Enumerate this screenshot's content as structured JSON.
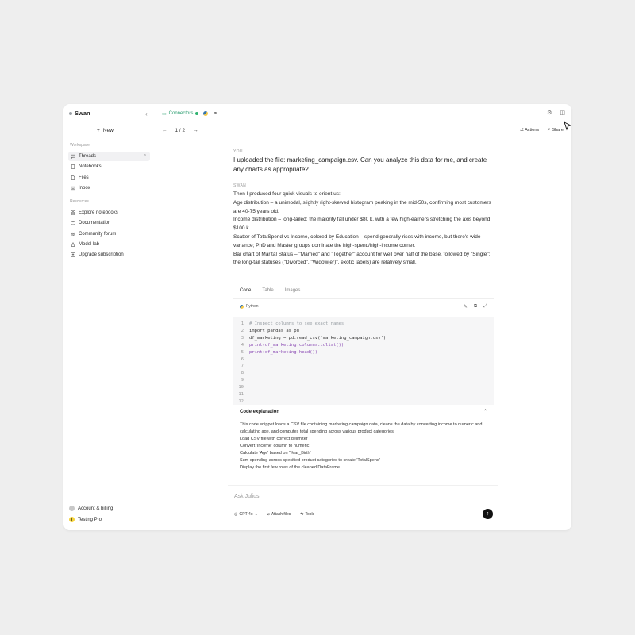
{
  "sidebar": {
    "brand": "Swan",
    "new_label": "New",
    "workspace_label": "Workspace",
    "items": [
      {
        "label": "Threads"
      },
      {
        "label": "Notebooks"
      },
      {
        "label": "Files"
      },
      {
        "label": "Inbox"
      }
    ],
    "resources_label": "Resources",
    "resources": [
      {
        "label": "Explore notebooks"
      },
      {
        "label": "Documentation"
      },
      {
        "label": "Community forum"
      },
      {
        "label": "Model lab"
      },
      {
        "label": "Upgrade subscription"
      }
    ],
    "account_label": "Account & billing",
    "user_label": "Testing Pro"
  },
  "topbar": {
    "connectors_label": "Connectors"
  },
  "pager": {
    "value": "1 / 2"
  },
  "actions": {
    "actions_label": "Actions",
    "share_label": "Share"
  },
  "messages": {
    "user_role": "YOU",
    "user_text": "I uploaded the file: marketing_campaign.csv. Can you analyze this data for me, and create any charts as appropriate?",
    "assistant_role": "SWAN",
    "assistant_lines": [
      "Then I produced four quick visuals to orient us:",
      "Age distribution – a unimodal, slightly right-skewed histogram peaking in the mid-50s, confirming most customers are 40-75 years old.",
      "Income distribution – long-tailed; the majority fall under $80 k, with a few high-earners stretching the axis beyond $100 k.",
      "Scatter of TotalSpend vs Income, colored by Education – spend generally rises with income, but there's wide variance; PhD and Master groups dominate the high-spend/high-income corner.",
      "Bar chart of Marital Status – \"Married\" and \"Together\" account for well over half of the base, followed by \"Single\"; the long-tail statuses (\"Divorced\", \"Widow(er)\", exotic labels) are relatively small."
    ]
  },
  "code_card": {
    "tabs": [
      "Code",
      "Table",
      "Images"
    ],
    "language": "Python",
    "line_numbers": [
      "1",
      "2",
      "3",
      "4",
      "5",
      "6",
      "7",
      "8",
      "9",
      "10",
      "11",
      "12"
    ],
    "code_lines": [
      "# Inspect columns to see exact names",
      "import pandas as pd",
      "df_marketing = pd.read_csv('marketing_campaign.csv')",
      "print(df_marketing.columns.tolist())",
      "print(df_marketing.head())"
    ],
    "explanation_title": "Code explanation",
    "explanation_lines": [
      "This code snippet loads a CSV file containing marketing campaign data, cleans the data by converting income to numeric and calculating age, and computes total spending across various product categories.",
      "Load CSV file with correct delimiter",
      "Convert 'Income' column to numeric",
      "Calculate 'Age' based on 'Year_Birth'",
      "Sum spending across specified product categories to create 'TotalSpend'",
      "Display the first few rows of the cleaned DataFrame"
    ]
  },
  "input": {
    "placeholder": "Ask Julius",
    "model_label": "GPT-4o",
    "attach_label": "Attach files",
    "tools_label": "Tools"
  }
}
